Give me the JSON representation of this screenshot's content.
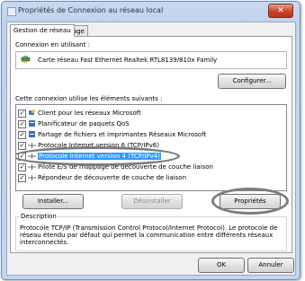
{
  "window": {
    "title": "Propriétés de Connexion au réseau local",
    "close_label": "✕"
  },
  "tabs": [
    {
      "label": "Gestion de réseau",
      "active": true
    },
    {
      "label": "Partage",
      "active": false
    }
  ],
  "connect_using": {
    "label": "Connexion en utilisant :",
    "adapter_name": "Carte réseau Fast Ethernet Realtek RTL8139/810x Family",
    "configure_label": "Configurer..."
  },
  "items_section": {
    "label": "Cette connexion utilise les éléments suivants :",
    "items": [
      {
        "label": "Client pour les réseaux Microsoft",
        "checked": true,
        "icon": "network-client-icon"
      },
      {
        "label": "Planificateur de paquets QoS",
        "checked": true,
        "icon": "scheduler-icon"
      },
      {
        "label": "Partage de fichiers et imprimantes Réseaux Microsoft",
        "checked": true,
        "icon": "file-share-icon"
      },
      {
        "label": "Protocole Internet version 6 (TCP/IPv6)",
        "checked": true,
        "icon": "protocol-icon"
      },
      {
        "label": "Protocole Internet version 4 (TCP/IPv4)",
        "checked": true,
        "icon": "protocol-icon",
        "selected": true
      },
      {
        "label": "Pilote E/S de mappage de découverte de couche liaison",
        "checked": true,
        "icon": "protocol-icon"
      },
      {
        "label": "Répondeur de découverte de couche de liaison",
        "checked": true,
        "icon": "protocol-icon"
      }
    ]
  },
  "buttons": {
    "install": "Installer...",
    "uninstall": "Désinstaller",
    "properties": "Propriétés",
    "ok": "OK",
    "cancel": "Annuler"
  },
  "description": {
    "title": "Description",
    "text": "Protocole TCP/IP (Transmission Control Protocol/Internet Protocol). Le protocole de réseau étendu par défaut qui permet la communication entre différents réseaux interconnectés."
  },
  "colors": {
    "selection": "#3399ff",
    "highlight_ellipse": "#7c7c7c"
  }
}
